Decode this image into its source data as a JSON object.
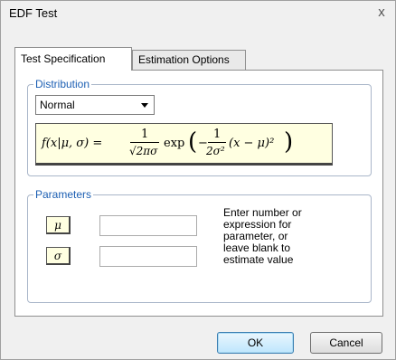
{
  "window": {
    "title": "EDF Test",
    "close_glyph": "x"
  },
  "tabs": [
    {
      "label": "Test Specification",
      "active": true
    },
    {
      "label": "Estimation Options",
      "active": false
    }
  ],
  "distribution": {
    "group_label": "Distribution",
    "selected": "Normal",
    "formula": {
      "lhs": "f(x|μ, σ)  =",
      "frac_num": "1",
      "frac_den": "√2πσ",
      "exp": "exp",
      "inner_num": "1",
      "inner_den": "2σ²",
      "tail": "(x − μ)²"
    }
  },
  "parameters": {
    "group_label": "Parameters",
    "items": [
      {
        "symbol": "μ",
        "value": ""
      },
      {
        "symbol": "σ",
        "value": ""
      }
    ],
    "hint": "Enter number or\nexpression for\nparameter, or\nleave blank to\nestimate value"
  },
  "buttons": {
    "ok": "OK",
    "cancel": "Cancel"
  },
  "colors": {
    "group_label": "#1c5fb3",
    "formula_bg": "#ffffe1",
    "default_button": "#bee6fd"
  }
}
